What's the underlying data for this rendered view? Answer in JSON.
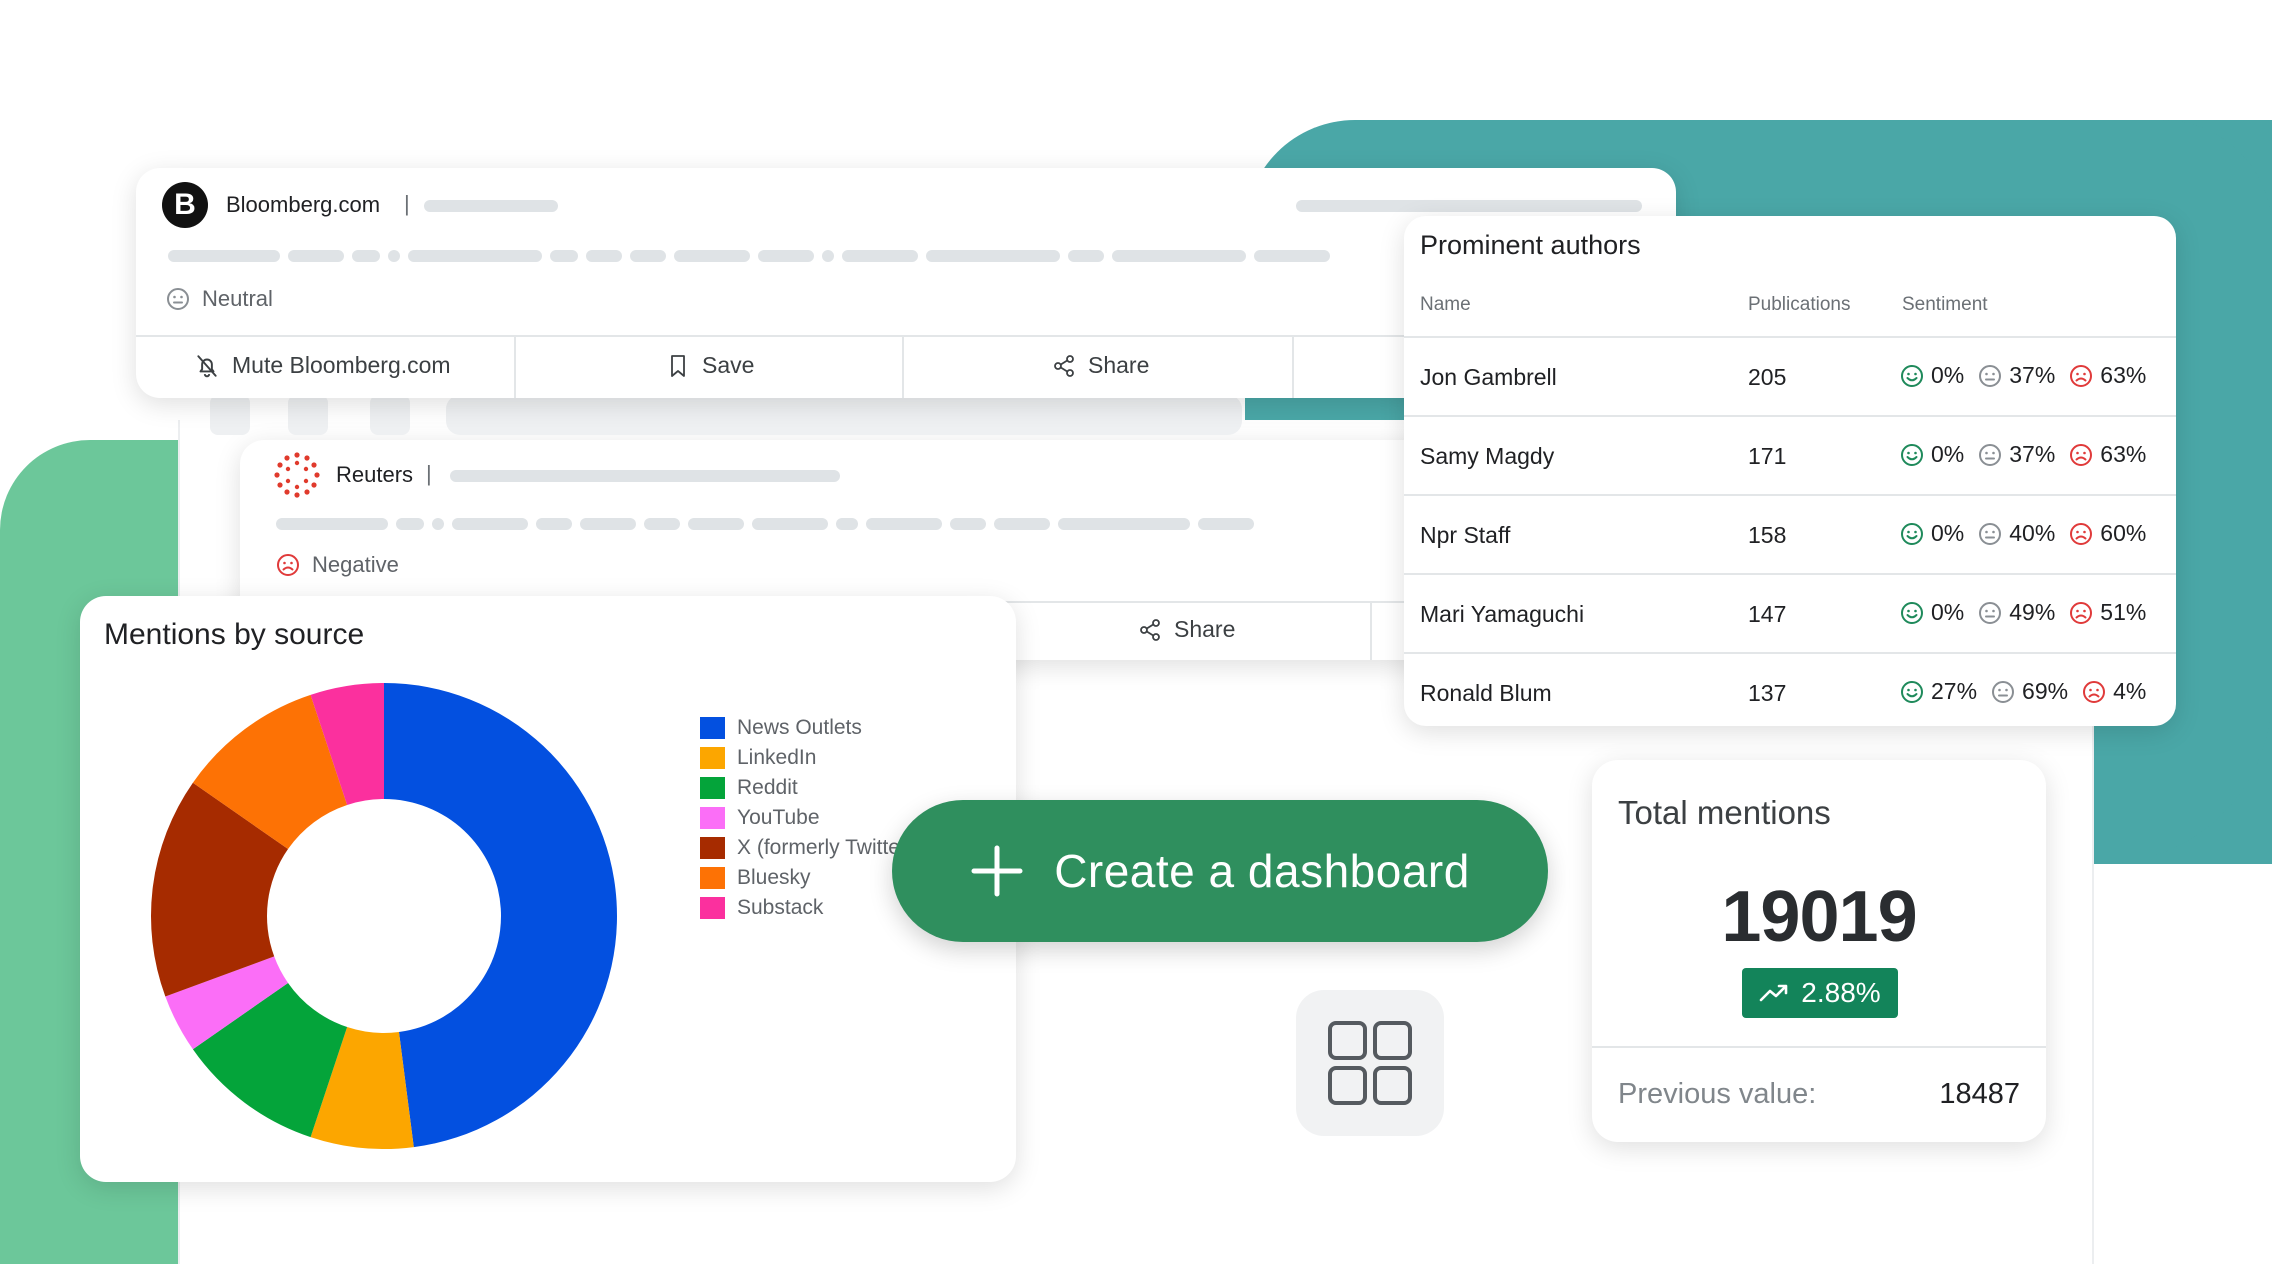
{
  "colors": {
    "teal": "#4aa7a7",
    "green_bg": "#6cc79a",
    "cta_green": "#2f8f5e",
    "badge_green": "#13845a",
    "positive": "#1f8a5b",
    "negative": "#e03a3a",
    "neutral": "#8a8f94"
  },
  "mention1": {
    "source": "Bloomberg.com",
    "divider": "|",
    "sentiment": "Neutral",
    "actions": {
      "mute": "Mute Bloomberg.com",
      "save": "Save",
      "share": "Share"
    }
  },
  "mention2": {
    "source": "Reuters",
    "divider": "|",
    "sentiment": "Negative",
    "actions": {
      "share": "Share"
    }
  },
  "authors": {
    "title": "Prominent authors",
    "columns": {
      "name": "Name",
      "publications": "Publications",
      "sentiment": "Sentiment"
    },
    "rows": [
      {
        "name": "Jon Gambrell",
        "publications": "205",
        "positive": "0%",
        "neutral": "37%",
        "negative": "63%"
      },
      {
        "name": "Samy Magdy",
        "publications": "171",
        "positive": "0%",
        "neutral": "37%",
        "negative": "63%"
      },
      {
        "name": "Npr Staff",
        "publications": "158",
        "positive": "0%",
        "neutral": "40%",
        "negative": "60%"
      },
      {
        "name": "Mari Yamaguchi",
        "publications": "147",
        "positive": "0%",
        "neutral": "49%",
        "negative": "51%"
      },
      {
        "name": "Ronald Blum",
        "publications": "137",
        "positive": "27%",
        "neutral": "69%",
        "negative": "4%"
      }
    ]
  },
  "mentions_by_source": {
    "title": "Mentions by source"
  },
  "chart_data": {
    "type": "pie",
    "donut": true,
    "title": "Mentions by source",
    "legend_position": "right",
    "categories": [
      "News Outlets",
      "LinkedIn",
      "Reddit",
      "YouTube",
      "X (formerly Twitter)",
      "Bluesky",
      "Substack"
    ],
    "values": [
      47,
      7,
      10,
      4,
      15,
      10,
      5
    ],
    "colors": [
      "#0350e0",
      "#fca600",
      "#04a43a",
      "#fb6ef7",
      "#a62b00",
      "#fd7205",
      "#fb309e"
    ]
  },
  "cta": {
    "label": "Create a dashboard",
    "icon": "plus-icon"
  },
  "dashboard_icon": "grid-icon",
  "total_mentions": {
    "title": "Total mentions",
    "value": "19019",
    "change": "2.88%",
    "change_icon": "trending-up-icon",
    "previous_label": "Previous value:",
    "previous_value": "18487"
  }
}
